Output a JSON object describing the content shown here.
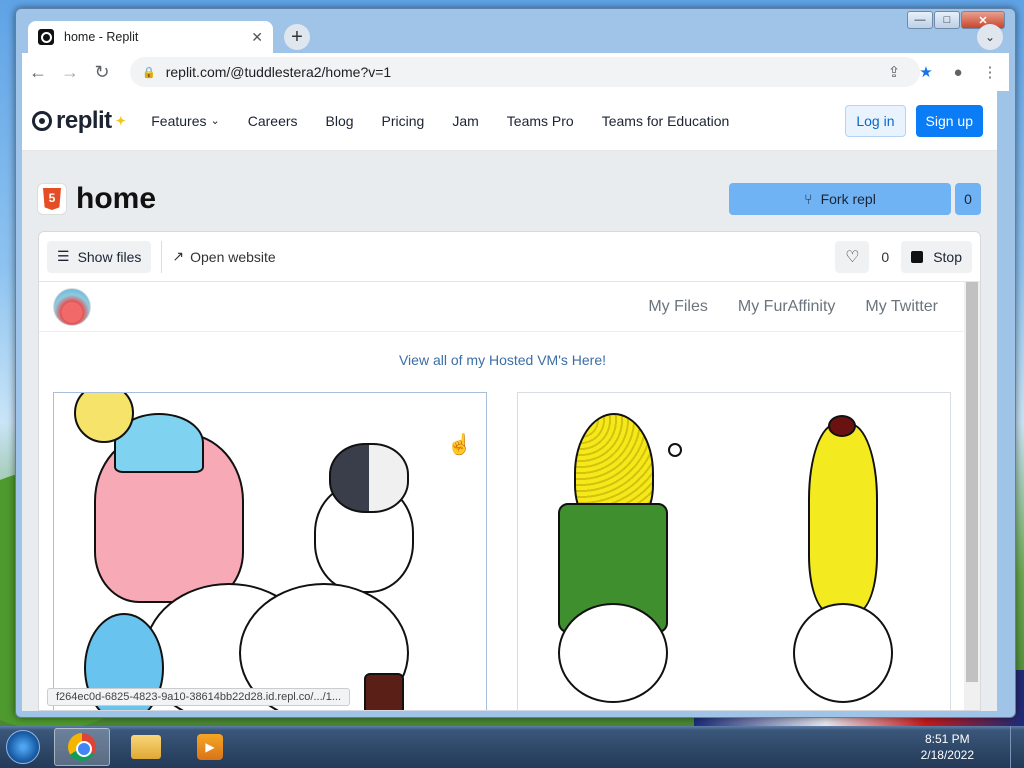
{
  "window": {
    "minimize": "—",
    "maximize": "□",
    "close": "✕"
  },
  "tab": {
    "title": "home - Replit",
    "close": "✕"
  },
  "browser": {
    "url": "replit.com/@tuddlestera2/home?v=1",
    "new_tab": "+"
  },
  "nav": {
    "logo": "replit",
    "links": [
      "Features",
      "Careers",
      "Blog",
      "Pricing",
      "Jam",
      "Teams Pro",
      "Teams for Education"
    ],
    "login": "Log in",
    "signup": "Sign up"
  },
  "repl": {
    "name": "home",
    "fork_label": "Fork repl",
    "fork_count": "0"
  },
  "toolbar": {
    "show_files": "Show files",
    "open_website": "Open website",
    "like_count": "0",
    "stop": "Stop"
  },
  "site": {
    "links": [
      "My Files",
      "My FurAffinity",
      "My Twitter"
    ],
    "vm_link": "View all of my Hosted VM's Here!"
  },
  "status_url": "f264ec0d-6825-4823-9a10-38614bb22d28.id.repl.co/.../1...",
  "clock": {
    "time": "8:51 PM",
    "date": "2/18/2022"
  },
  "icons": [
    "replit-logo-icon",
    "html5-icon",
    "fork-icon",
    "files-icon",
    "external-link-icon",
    "heart-icon",
    "stop-icon",
    "lock-icon",
    "share-icon",
    "star-icon",
    "profile-icon",
    "menu-icon",
    "chrome-icon",
    "explorer-icon",
    "media-player-icon",
    "windows-start-icon"
  ],
  "colors": {
    "accent": "#0a7cf5",
    "fork": "#6fb3f5",
    "taskbar": "#233a58"
  }
}
